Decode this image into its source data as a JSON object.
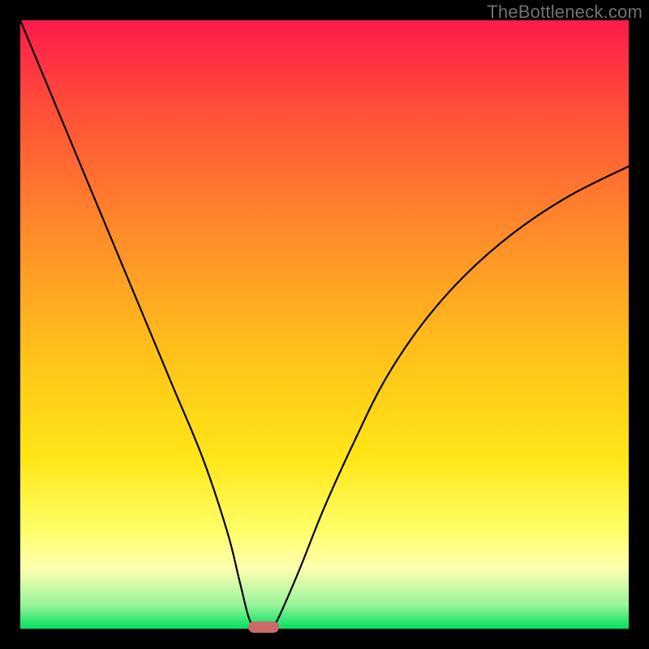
{
  "watermark": "TheBottleneck.com",
  "colors": {
    "frame": "#000000",
    "curve": "#000000",
    "marker": "#cc6a6a",
    "gradient_top": "#ff1a4b",
    "gradient_mid": "#ffe617",
    "gradient_bottom": "#00e060"
  },
  "chart_data": {
    "type": "line",
    "title": "",
    "xlabel": "",
    "ylabel": "",
    "xlim": [
      0,
      100
    ],
    "ylim": [
      0,
      100
    ],
    "grid": false,
    "annotations": [
      {
        "text": "TheBottleneck.com",
        "position": "top-right"
      }
    ],
    "series": [
      {
        "name": "left-branch",
        "x": [
          0,
          5,
          10,
          15,
          20,
          25,
          30,
          34,
          36,
          37.5,
          38.5
        ],
        "y": [
          100,
          88,
          76,
          64,
          52,
          40,
          28,
          16,
          8,
          2,
          0
        ]
      },
      {
        "name": "right-branch",
        "x": [
          41.5,
          43,
          46,
          50,
          55,
          60,
          66,
          73,
          81,
          90,
          100
        ],
        "y": [
          0,
          3,
          10,
          20,
          31,
          41,
          50,
          58,
          65,
          71,
          76
        ]
      }
    ],
    "marker": {
      "x": 40,
      "y": 0,
      "shape": "rounded-rect",
      "color": "#cc6a6a"
    },
    "background_gradient": {
      "direction": "vertical",
      "stops": [
        {
          "pos": 0.0,
          "color": "#ff1a4b"
        },
        {
          "pos": 0.15,
          "color": "#ff5038"
        },
        {
          "pos": 0.35,
          "color": "#ff8c2a"
        },
        {
          "pos": 0.55,
          "color": "#ffc21a"
        },
        {
          "pos": 0.72,
          "color": "#ffe617"
        },
        {
          "pos": 0.84,
          "color": "#ffff6a"
        },
        {
          "pos": 0.9,
          "color": "#ffffb0"
        },
        {
          "pos": 0.96,
          "color": "#9bf49b"
        },
        {
          "pos": 1.0,
          "color": "#00e060"
        }
      ]
    }
  }
}
